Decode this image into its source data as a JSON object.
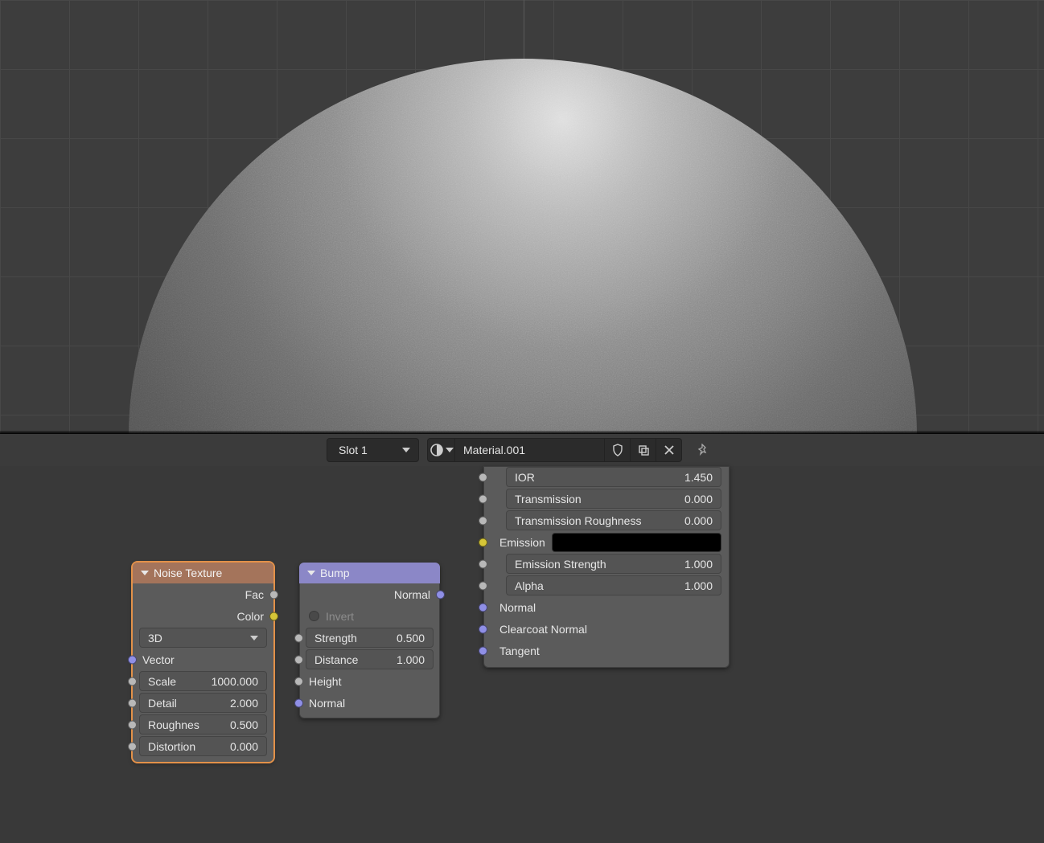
{
  "header": {
    "slot_label": "Slot 1",
    "material_name": "Material.001"
  },
  "shader": {
    "rows": [
      {
        "label": "IOR",
        "value": "1.450",
        "socket": "grey",
        "field": true
      },
      {
        "label": "Transmission",
        "value": "0.000",
        "socket": "grey",
        "field": true
      },
      {
        "label": "Transmission Roughness",
        "value": "0.000",
        "socket": "grey",
        "field": true
      },
      {
        "label": "Emission",
        "value": "",
        "socket": "yellow",
        "swatch": true
      },
      {
        "label": "Emission Strength",
        "value": "1.000",
        "socket": "grey",
        "field": true
      },
      {
        "label": "Alpha",
        "value": "1.000",
        "socket": "grey",
        "field": true
      },
      {
        "label": "Normal",
        "value": "",
        "socket": "purple"
      },
      {
        "label": "Clearcoat Normal",
        "value": "",
        "socket": "purple"
      },
      {
        "label": "Tangent",
        "value": "",
        "socket": "purple"
      }
    ]
  },
  "noise": {
    "title": "Noise Texture",
    "out_fac": "Fac",
    "out_color": "Color",
    "dim": "3D",
    "in_vector": "Vector",
    "scale_label": "Scale",
    "scale_value": "1000.000",
    "detail_label": "Detail",
    "detail_value": "2.000",
    "rough_label": "Roughnes",
    "rough_value": "0.500",
    "dist_label": "Distortion",
    "dist_value": "0.000"
  },
  "bump": {
    "title": "Bump",
    "out_normal": "Normal",
    "invert_label": "Invert",
    "strength_label": "Strength",
    "strength_value": "0.500",
    "distance_label": "Distance",
    "distance_value": "1.000",
    "in_height": "Height",
    "in_normal": "Normal"
  }
}
